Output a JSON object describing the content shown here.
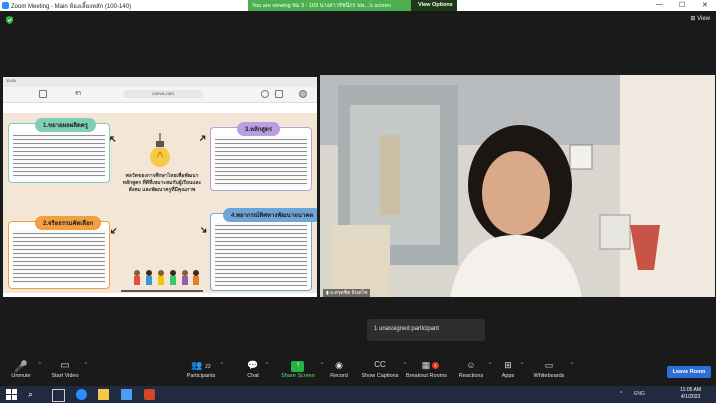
{
  "window": {
    "title": "Zoom Meeting - Main ห้องเลี้ยงหลัก (100-140)",
    "share_banner": "You are viewing ชม 3 - 109 นางสาวรัชนีกร นพ...'s screen",
    "view_options_label": "View Options",
    "minimize": "—",
    "maximize": "☐",
    "close": "✕"
  },
  "meeting": {
    "view_label": "View",
    "participant_name": "อ.ศรุตชิต อินทโซ",
    "notification": "1 unassigned participant"
  },
  "shared_screen": {
    "browser_time": "11:05",
    "url": "canva.com",
    "tab_hint": "ชีวิ",
    "cards": [
      {
        "heading": "1.ขยายผลผลิตครู"
      },
      {
        "heading": "2.จริยธรรมคัดเลือก"
      },
      {
        "heading": "3.หลักสูตร"
      },
      {
        "heading": "4.พยากรณ์ทิศทางพัฒนาอนาคต"
      }
    ],
    "center_text": "พลวัตของการศึกษาไทยเพื่อพัฒนาหลักสูตร ที่ดีที่เหมาะสมกับผู้เรียนและสังคม และพัฒนาครูที่มีคุณภาพ"
  },
  "toolbar": {
    "unmute": "Unmute",
    "start_video": "Start Video",
    "participants": "Participants",
    "participants_count": "22",
    "chat": "Chat",
    "share_screen": "Share Screen",
    "record": "Record",
    "show_captions": "Show Captions",
    "breakout_rooms": "Breakout Rooms",
    "breakout_badge": "1",
    "reactions": "Reactions",
    "apps": "Apps",
    "whiteboards": "Whiteboards",
    "leave_room": "Leave Room"
  },
  "taskbar": {
    "time": "11:05 AM",
    "date": "4/1/2023",
    "lang": "ENG"
  },
  "colors": {
    "share_green": "#4caf50",
    "leave_blue": "#2d6fd6",
    "card_green": "#7fcfb7",
    "card_orange": "#f29f3f",
    "card_purple": "#b8a0e0",
    "card_blue": "#6ea5d9"
  }
}
